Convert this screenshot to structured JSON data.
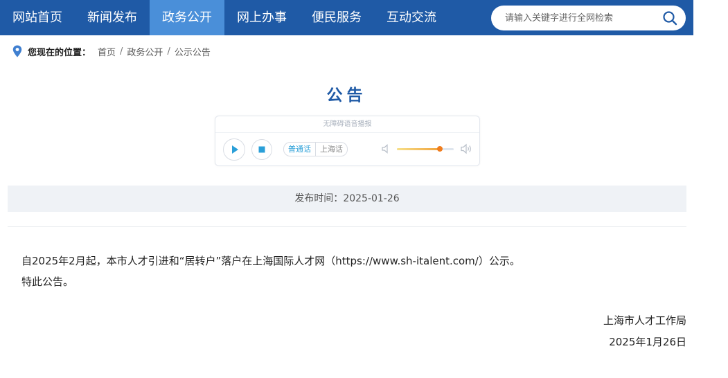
{
  "nav": {
    "items": [
      {
        "label": "网站首页",
        "active": false
      },
      {
        "label": "新闻发布",
        "active": false
      },
      {
        "label": "政务公开",
        "active": true
      },
      {
        "label": "网上办事",
        "active": false
      },
      {
        "label": "便民服务",
        "active": false
      },
      {
        "label": "互动交流",
        "active": false
      }
    ],
    "search_placeholder": "请输入关键字进行全网检索"
  },
  "breadcrumb": {
    "lead": "您现在的位置：",
    "items": [
      "首页",
      "政务公开",
      "公示公告"
    ],
    "separator": "/"
  },
  "article": {
    "title": "公告",
    "publish_label": "发布时间：",
    "publish_date": "2025-01-26",
    "paragraphs": [
      "自2025年2月起，本市人才引进和“居转户”落户在上海国际人才网（https://www.sh-italent.com/）公示。",
      "特此公告。"
    ],
    "signature": "上海市人才工作局",
    "signature_date": "2025年1月26日"
  },
  "player": {
    "header": "无障碍语音播报",
    "lang_options": [
      "普通话",
      "上海话"
    ],
    "selected_lang": "普通话",
    "volume": 0.76
  },
  "colors": {
    "nav_bg": "#1f5aa6",
    "nav_active": "#4a8fd9",
    "title": "#1f5aa6",
    "player_accent": "#2a9fd8",
    "volume_knob": "#f07d1e"
  }
}
